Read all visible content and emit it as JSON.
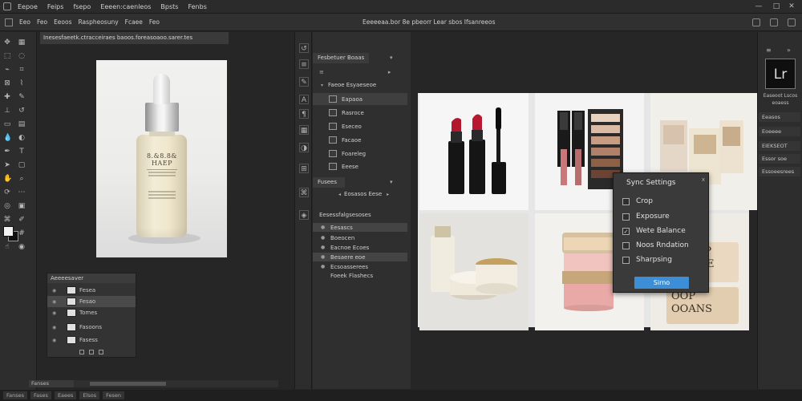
{
  "menubar": {
    "items": [
      "Eepoe",
      "Feips",
      "fsepo",
      "Eeeen:caenleos",
      "Bpsts",
      "Fenbs"
    ],
    "window_buttons": [
      "—",
      "□",
      "✕"
    ]
  },
  "optbar": {
    "items": [
      "Eeo",
      "Feo",
      "Eeoos",
      "Raspheosuny",
      "Fcaee",
      "Feo"
    ],
    "center_title": "Eeeeeaa.bor 8e pbeorr Lear sbos  Ifsanreeos"
  },
  "document": {
    "tab": "Inesesfaeetk.ctracceiraes baoos.foreasoaoo.sarer.tes",
    "bottle_label": [
      "8.&8.8&",
      "HAEP"
    ],
    "status": "Fanses",
    "bottom_items": [
      "Fanses",
      "Fases",
      "Eaees",
      "Elsos",
      "Fesen"
    ]
  },
  "layers_panel": {
    "title": "Aeeeesaver",
    "layers": [
      {
        "label": "Fesea",
        "selected": false
      },
      {
        "label": "Fesao",
        "selected": true
      },
      {
        "label": "Tomes",
        "selected": false
      },
      {
        "label": "Fasoons",
        "selected": false
      },
      {
        "label": "Fasess",
        "selected": false
      }
    ]
  },
  "mid_panels": {
    "tab1": "Fesbetuer Boaas",
    "group_label": "Faeoe  Esyaeseoe",
    "items": [
      {
        "label": "Eapaoa",
        "selected": true
      },
      {
        "label": "Rasroce",
        "selected": false
      },
      {
        "label": "Eseceo",
        "selected": false
      },
      {
        "label": "Facaoe",
        "selected": false
      },
      {
        "label": "Foareleg",
        "selected": false
      },
      {
        "label": "Eeese",
        "selected": false
      }
    ],
    "tab2": "Fusees",
    "tab2_row": "Eosasos Eese",
    "history_title": "Eesessfalgsesoses",
    "history": [
      {
        "label": "Eesascs",
        "selected": true
      },
      {
        "label": "Boeocen",
        "selected": false
      },
      {
        "label": "Eacnoe Ecoes",
        "selected": false
      },
      {
        "label": "Besaere eoe",
        "selected": true
      },
      {
        "label": "Ecsoasserees",
        "selected": false
      },
      {
        "label": "Foeek Flashecs",
        "selected": false
      }
    ]
  },
  "grid": {
    "cell5_text": [
      "OOP",
      "EAIE",
      "OOP",
      "OOANS"
    ]
  },
  "sync_dialog": {
    "title": "Sync Settings",
    "close": "x",
    "options": [
      {
        "label": "Crop",
        "checked": false
      },
      {
        "label": "Exposure",
        "checked": false
      },
      {
        "label": "Wete Balance",
        "checked": true
      },
      {
        "label": "Noos Rndation",
        "checked": false
      },
      {
        "label": "Sharpsing",
        "checked": false
      }
    ],
    "button": "Sirno"
  },
  "right_panel": {
    "badge": "Lr",
    "caption": [
      "Easeoot Lscos",
      "eoaess"
    ],
    "items": [
      "Eeasos",
      "Eoeeee",
      "EIEKSEOT",
      "Essor soe",
      "Essoeesrees"
    ]
  },
  "colors": {
    "accent": "#3c8fd6",
    "app_bg": "#262626",
    "panel_bg": "#2f2f2f"
  },
  "icons": [
    "app-icon",
    "eye-icon",
    "close-icon",
    "checkbox-icon",
    "lightroom-icon"
  ]
}
